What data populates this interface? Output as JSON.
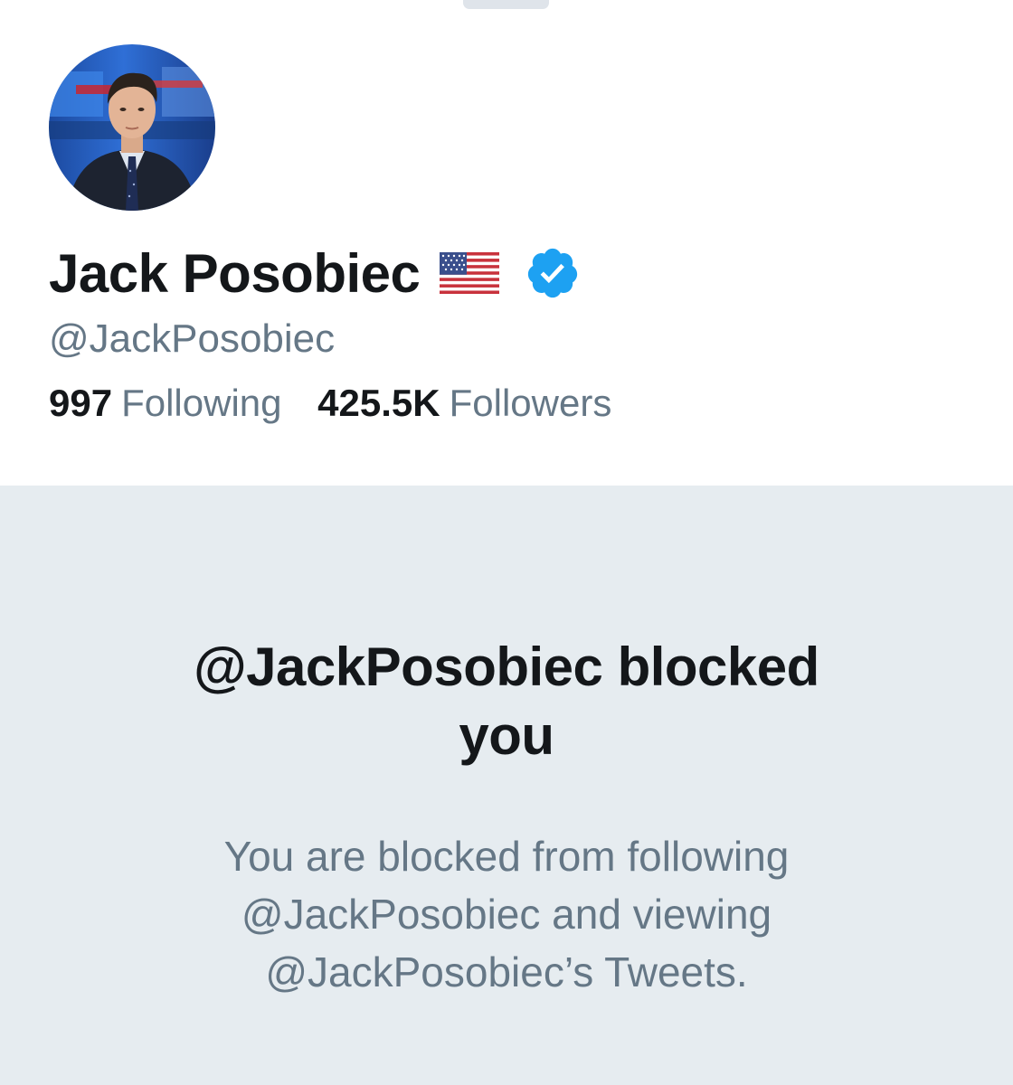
{
  "profile": {
    "display_name": "Jack Posobiec",
    "flag_emoji": "us-flag",
    "verified": true,
    "handle": "@JackPosobiec",
    "following_count": "997",
    "following_label": "Following",
    "followers_count": "425.5K",
    "followers_label": "Followers"
  },
  "blocked": {
    "title_line1": "@JackPosobiec blocked",
    "title_line2": "you",
    "message_line1": "You are blocked from following",
    "message_line2": "@JackPosobiec and viewing",
    "message_line3": "@JackPosobiec’s Tweets."
  },
  "colors": {
    "primary_text": "#14171a",
    "secondary_text": "#657786",
    "verified_blue": "#1da1f2",
    "blocked_background": "#e6ecf0"
  }
}
